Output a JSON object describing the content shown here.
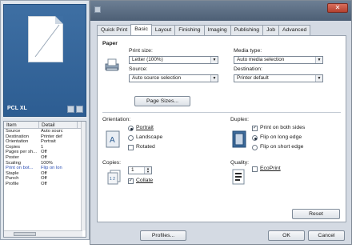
{
  "left_pane": {
    "preview_label": "PCL XL",
    "summary": {
      "headers": [
        "Item",
        "Detail"
      ],
      "rows": [
        {
          "item": "Source",
          "detail": "Auto sourc"
        },
        {
          "item": "Destination",
          "detail": "Printer def"
        },
        {
          "item": "Orientation",
          "detail": "Portrait"
        },
        {
          "item": "Copies",
          "detail": "1"
        },
        {
          "item": "Pages per sh...",
          "detail": "Off"
        },
        {
          "item": "Poster",
          "detail": "Off"
        },
        {
          "item": "Scaling",
          "detail": "100%"
        },
        {
          "item": "Print on bot...",
          "detail": "Flip on lon"
        },
        {
          "item": "Staple",
          "detail": "Off"
        },
        {
          "item": "Punch",
          "detail": "Off"
        },
        {
          "item": "Profile",
          "detail": "Off"
        }
      ],
      "highlight_color": "#2d50b5"
    }
  },
  "dialog": {
    "tabs": [
      "Quick Print",
      "Basic",
      "Layout",
      "Finishing",
      "Imaging",
      "Publishing",
      "Job",
      "Advanced"
    ],
    "active_tab": "Basic",
    "paper": {
      "section_label": "Paper",
      "print_size_label": "Print size:",
      "print_size_value": "Letter (100%)",
      "media_type_label": "Media type:",
      "media_type_value": "Auto media selection",
      "source_label": "Source:",
      "source_value": "Auto source selection",
      "destination_label": "Destination:",
      "destination_value": "Printer default",
      "page_sizes_button": "Page Sizes..."
    },
    "orientation": {
      "label": "Orientation:",
      "options": [
        "Portrait",
        "Landscape",
        "Rotated"
      ],
      "selected": "Portrait"
    },
    "duplex": {
      "label": "Duplex:",
      "print_both_sides": "Print on both sides",
      "print_both_sides_checked": true,
      "options": [
        "Flip on long edge",
        "Flip on short edge"
      ],
      "selected": "Flip on long edge"
    },
    "copies": {
      "label": "Copies:",
      "value": "1",
      "collate_label": "Collate",
      "collate_checked": true
    },
    "quality": {
      "label": "Quality:",
      "econoprint_label": "EcoPrint",
      "econoprint_checked": false
    },
    "buttons": {
      "reset": "Reset",
      "profiles": "Profiles...",
      "ok": "OK",
      "cancel": "Cancel"
    }
  }
}
